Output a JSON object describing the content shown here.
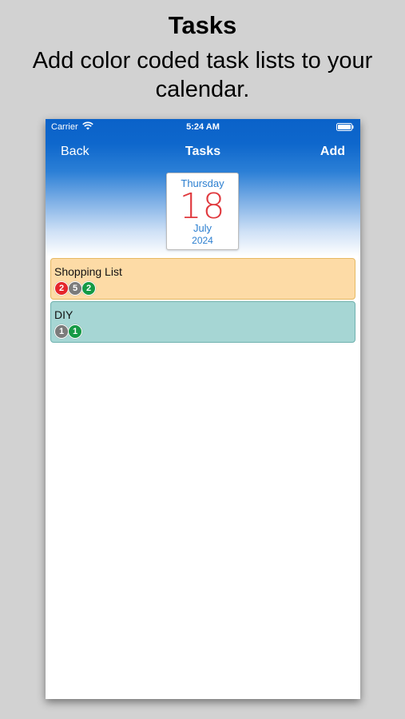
{
  "promo": {
    "title": "Tasks",
    "subtitle": "Add color coded task lists to your calendar."
  },
  "status_bar": {
    "carrier": "Carrier",
    "time": "5:24 AM"
  },
  "nav": {
    "back_label": "Back",
    "title": "Tasks",
    "add_label": "Add"
  },
  "date_card": {
    "weekday": "Thursday",
    "day": "18",
    "month": "July",
    "year": "2024"
  },
  "task_lists": [
    {
      "name": "Shopping List",
      "color": "#fddba6",
      "badges": [
        {
          "count": "2",
          "color": "#e5262b"
        },
        {
          "count": "5",
          "color": "#7b7b7b"
        },
        {
          "count": "2",
          "color": "#159a45"
        }
      ]
    },
    {
      "name": "DIY",
      "color": "#a6d6d4",
      "badges": [
        {
          "count": "1",
          "color": "#7b7b7b"
        },
        {
          "count": "1",
          "color": "#159a45"
        }
      ]
    }
  ],
  "colors": {
    "header_blue": "#0a62c9",
    "date_accent": "#2c7fd0",
    "date_day_red": "#e0393e"
  }
}
